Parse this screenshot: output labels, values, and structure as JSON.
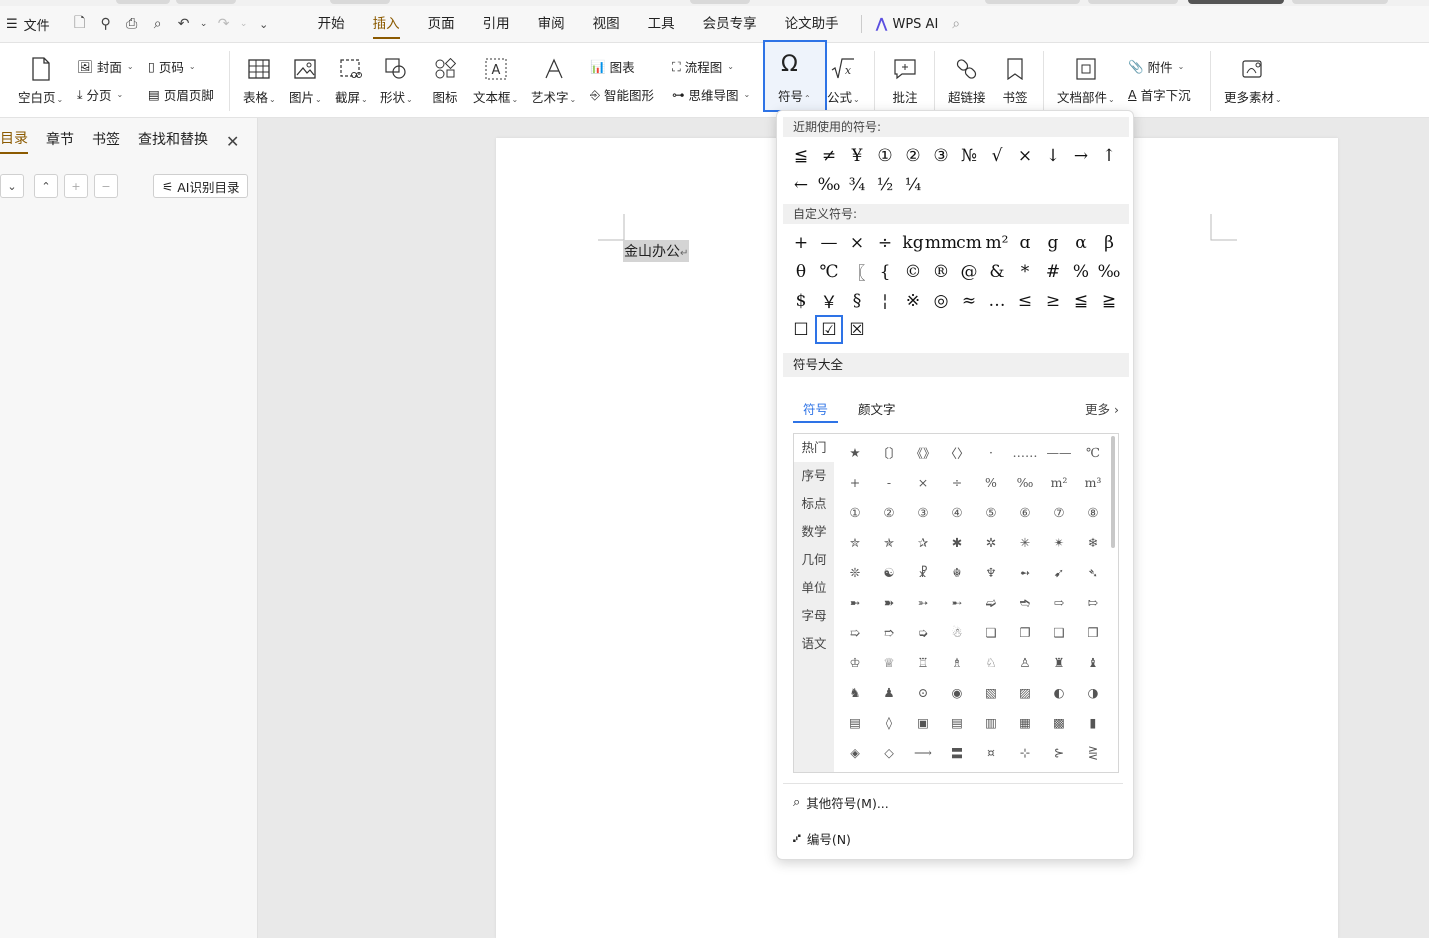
{
  "menubar": {
    "file": "文件",
    "tabs": [
      "开始",
      "插入",
      "页面",
      "引用",
      "审阅",
      "视图",
      "工具",
      "会员专享",
      "论文助手"
    ],
    "active_tab": "插入",
    "wps_ai": "WPS AI"
  },
  "ribbon": {
    "blank_page": "空白页",
    "cover": "封面",
    "page_break": "分页",
    "page_number": "页码",
    "header_footer": "页眉页脚",
    "table": "表格",
    "picture": "图片",
    "screenshot": "截屏",
    "shape": "形状",
    "icon": "图标",
    "textbox": "文本框",
    "wordart": "艺术字",
    "chart": "图表",
    "smart_graphic": "智能图形",
    "flowchart": "流程图",
    "mindmap": "思维导图",
    "symbol": "符号",
    "formula": "公式",
    "comment": "批注",
    "hyperlink": "超链接",
    "bookmark": "书签",
    "doc_parts": "文档部件",
    "attachment": "附件",
    "drop_cap": "首字下沉",
    "more_material": "更多素材"
  },
  "navpane": {
    "tabs": [
      "目录",
      "章节",
      "书签",
      "查找和替换"
    ],
    "ai_button": "AI识别目录"
  },
  "document": {
    "text": "金山办公"
  },
  "symbol_panel": {
    "recent_title": "近期使用的符号:",
    "recent": [
      "≦",
      "≠",
      "¥",
      "①",
      "②",
      "③",
      "№",
      "√",
      "×",
      "↓",
      "→",
      "↑",
      "←",
      "‰",
      "¾",
      "½",
      "¼"
    ],
    "custom_title": "自定义符号:",
    "custom": [
      "+",
      "—",
      "×",
      "÷",
      "kg",
      "mm",
      "cm",
      "m²",
      "ɑ",
      "g",
      "α",
      "β",
      "θ",
      "℃",
      "〖",
      "{",
      "©",
      "®",
      "@",
      "&",
      "*",
      "#",
      "%",
      "‰",
      "$",
      "￥",
      "§",
      "¦",
      "※",
      "◎",
      "≈",
      "…",
      "≤",
      "≥",
      "≦",
      "≧",
      "☐",
      "☑",
      "☒"
    ],
    "selected_symbol": "☑",
    "all_title": "符号大全",
    "tabs": [
      "符号",
      "颜文字"
    ],
    "more": "更多",
    "categories": [
      "热门",
      "序号",
      "标点",
      "数学",
      "几何",
      "单位",
      "字母",
      "语文"
    ],
    "active_category": "热门",
    "all_symbols": [
      "★",
      "〔〕",
      "《》",
      "〈〉",
      "·",
      "……",
      "——",
      "℃",
      "+",
      "-",
      "×",
      "÷",
      "%",
      "‰",
      "m²",
      "m³",
      "①",
      "②",
      "③",
      "④",
      "⑤",
      "⑥",
      "⑦",
      "⑧",
      "✮",
      "✯",
      "✰",
      "✱",
      "✲",
      "✳",
      "✴",
      "❄",
      "❊",
      "☯",
      "☧",
      "☬",
      "♆",
      "➻",
      "➹",
      "➴",
      "➼",
      "➽",
      "➳",
      "➸",
      "➫",
      "➬",
      "⇨",
      "⇰",
      "➯",
      "➱",
      "➭",
      "☃",
      "❏",
      "❐",
      "❑",
      "❒",
      "♔",
      "♕",
      "♖",
      "♗",
      "♘",
      "♙",
      "♜",
      "♝",
      "♞",
      "♟",
      "⊙",
      "◉",
      "▧",
      "▨",
      "◐",
      "◑",
      "▤",
      "◊",
      "▣",
      "▤",
      "▥",
      "▦",
      "▩",
      "▮",
      "◈",
      "◇",
      "⟶",
      "〓",
      "¤",
      "⊹",
      "⊱",
      "⋛"
    ],
    "other_symbols": "其他符号(M)...",
    "numbering": "编号(N)"
  }
}
